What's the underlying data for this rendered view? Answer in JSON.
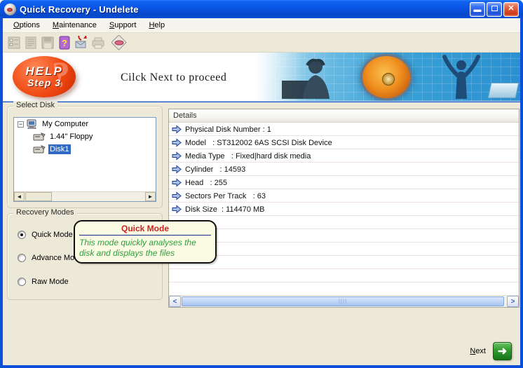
{
  "window": {
    "title": "Quick Recovery - Undelete",
    "controls": {
      "minimize_glyph": "_",
      "close_glyph": "✕"
    }
  },
  "menu": {
    "items": [
      {
        "label": "Options"
      },
      {
        "label": "Maintenance"
      },
      {
        "label": "Support"
      },
      {
        "label": "Help"
      }
    ]
  },
  "toolbar": {
    "icons": [
      "options-icon",
      "report-icon",
      "save-icon",
      "help-icon",
      "send-mail-icon",
      "print-icon",
      "exit-icon"
    ]
  },
  "banner": {
    "logo_line1": "HELP",
    "logo_line2": "Step 3",
    "message": "Cilck Next to proceed"
  },
  "select_disk": {
    "title": "Select Disk",
    "tree": [
      {
        "label": "My Computer",
        "level": 0,
        "expanded": true,
        "selected": false
      },
      {
        "label": "1.44\" Floppy",
        "level": 1,
        "selected": false
      },
      {
        "label": "Disk1",
        "level": 1,
        "selected": true
      }
    ]
  },
  "details": {
    "header": "Details",
    "rows": [
      "Physical Disk Number : 1",
      "Model   : ST312002 6AS SCSI Disk Device",
      "Media Type   : Fixed|hard disk media",
      "Cylinder   : 14593",
      "Head   : 255",
      "Sectors Per Track   : 63",
      "Disk Size  : 114470 MB"
    ]
  },
  "recovery_modes": {
    "title": "Recovery Modes",
    "options": [
      {
        "label": "Quick Mode",
        "selected": true
      },
      {
        "label": "Advance Mode",
        "selected": false
      },
      {
        "label": "Raw Mode",
        "selected": false
      }
    ]
  },
  "tooltip": {
    "title": "Quick Mode",
    "body": "This mode quickly analyses the disk and displays the files"
  },
  "footer": {
    "next_label": "Next"
  },
  "colors": {
    "titlebar_blue": "#0a55e5",
    "client_bg": "#ece9d8",
    "selection_blue": "#316ac5",
    "tooltip_bg": "#fbfae2",
    "tooltip_title_red": "#cc2222",
    "tooltip_body_green": "#2e9e3e",
    "next_button_green": "#2f9a2f"
  }
}
